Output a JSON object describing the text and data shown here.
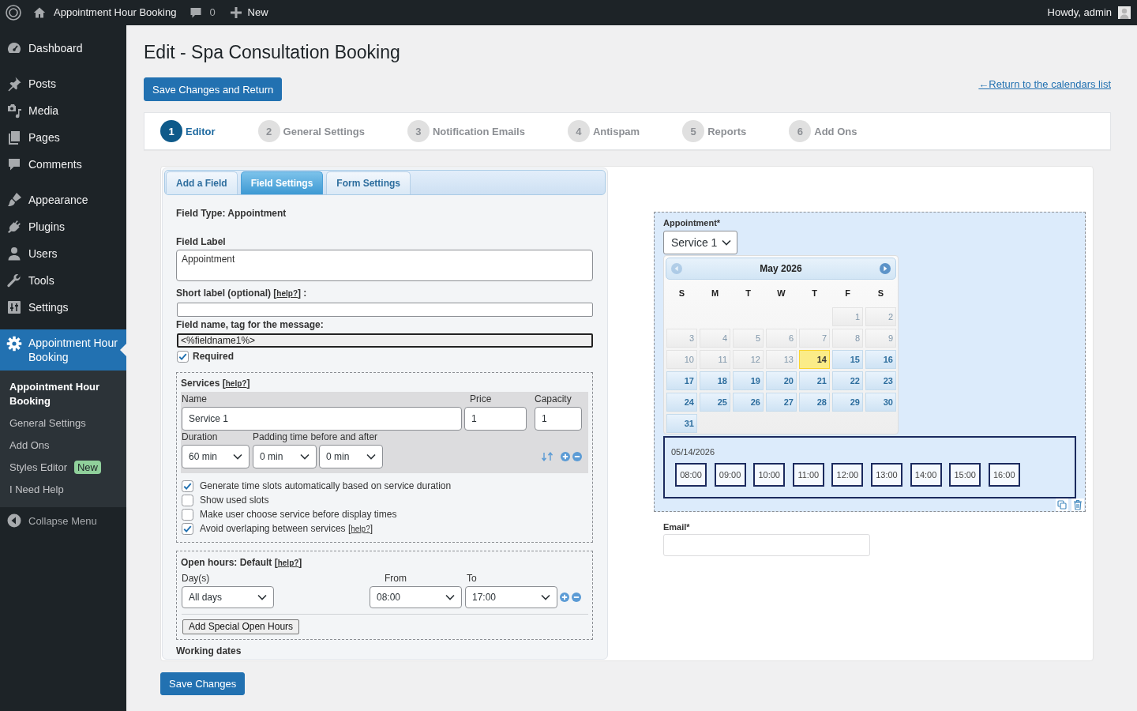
{
  "admin_bar": {
    "site_name": "Appointment Hour Booking",
    "comments_count": "0",
    "new_label": "New",
    "greeting": "Howdy, admin"
  },
  "sidebar": {
    "groups": [
      {
        "items": [
          {
            "label": "Dashboard",
            "selected": false
          }
        ]
      },
      {
        "items": [
          {
            "label": "Posts",
            "selected": false
          },
          {
            "label": "Media",
            "selected": false
          },
          {
            "label": "Pages",
            "selected": false
          },
          {
            "label": "Comments",
            "selected": false
          }
        ]
      },
      {
        "items": [
          {
            "label": "Appearance",
            "selected": false
          },
          {
            "label": "Plugins",
            "selected": false
          },
          {
            "label": "Users",
            "selected": false
          },
          {
            "label": "Tools",
            "selected": false
          },
          {
            "label": "Settings",
            "selected": false
          }
        ]
      },
      {
        "items": [
          {
            "label": "Appointment Hour Booking",
            "selected": true,
            "submenu": [
              {
                "label": "Appointment Hour Booking",
                "selected": true
              },
              {
                "label": "General Settings",
                "selected": false
              },
              {
                "label": "Add Ons",
                "selected": false
              },
              {
                "label": "Styles Editor",
                "selected": false,
                "badge": "New"
              },
              {
                "label": "I Need Help",
                "selected": false
              }
            ]
          }
        ]
      }
    ],
    "collapse_label": "Collapse Menu"
  },
  "page": {
    "title": "Edit - Spa Consultation Booking",
    "save_return_button": "Save Changes and Return",
    "return_link": "←Return to the calendars list"
  },
  "steps": [
    {
      "number": "1",
      "label": "Editor",
      "selected": true
    },
    {
      "number": "2",
      "label": "General Settings",
      "selected": false
    },
    {
      "number": "3",
      "label": "Notification Emails",
      "selected": false
    },
    {
      "number": "4",
      "label": "Antispam",
      "selected": false
    },
    {
      "number": "5",
      "label": "Reports",
      "selected": false
    },
    {
      "number": "6",
      "label": "Add Ons",
      "selected": false
    }
  ],
  "editor_tabs": [
    {
      "label": "Add a Field",
      "selected": false
    },
    {
      "label": "Field Settings",
      "selected": true
    },
    {
      "label": "Form Settings",
      "selected": false
    }
  ],
  "field_settings": {
    "field_type": "Field Type: Appointment",
    "field_label": {
      "label": "Field Label",
      "value": "Appointment"
    },
    "short_label": {
      "label": "Short label (optional)",
      "help": {
        "before": "[",
        "link": "help?",
        "after": "] :"
      }
    },
    "field_name": {
      "label": "Field name, tag for the message:",
      "value": "<%fieldname1%>"
    },
    "required": {
      "label": "Required",
      "checked": true
    },
    "services": {
      "title": "Services",
      "help": {
        "before": "[",
        "link": "help?",
        "after": "]"
      },
      "items": [
        {
          "name_label": "Name",
          "name": "Service 1",
          "price_label": "Price",
          "price": "1",
          "capacity_label": "Capacity",
          "capacity": "1",
          "duration_label": "Duration",
          "duration": "60 min",
          "padding_label": "Padding time before and after",
          "padding_before": "0 min",
          "padding_after": "0 min"
        }
      ],
      "options": [
        {
          "label": "Generate time slots automatically based on service duration",
          "checked": true
        },
        {
          "label": "Show used slots",
          "checked": false
        },
        {
          "label": "Make user choose service before display times",
          "checked": false
        },
        {
          "label": "Avoid overlaping between services",
          "checked": true,
          "help": {
            "before": "[",
            "link": "help?",
            "after": "]"
          }
        }
      ]
    },
    "open_hours": {
      "title": "Open hours: Default",
      "help": {
        "before": "[",
        "link": "help?",
        "after": "]"
      },
      "days_label": "Day(s)",
      "days": "All days",
      "from_label": "From",
      "from": "08:00",
      "to_label": "To",
      "to": "17:00",
      "special_button": "Add Special Open Hours"
    },
    "next_section": "Working dates"
  },
  "preview": {
    "appointment": {
      "label": "Appointment*",
      "service": "Service 1",
      "calendar": {
        "month": "May 2026",
        "prev_enabled": false,
        "next_enabled": true,
        "weekdays": [
          "S",
          "M",
          "T",
          "W",
          "T",
          "F",
          "S"
        ],
        "weeks": [
          [
            {
              "kind": "blank"
            },
            {
              "kind": "blank"
            },
            {
              "kind": "blank"
            },
            {
              "kind": "blank"
            },
            {
              "kind": "blank"
            },
            {
              "kind": "day",
              "label": "1",
              "available": false,
              "selected": false
            },
            {
              "kind": "day",
              "label": "2",
              "available": false,
              "selected": false
            }
          ],
          [
            {
              "kind": "day",
              "label": "3",
              "available": false,
              "selected": false
            },
            {
              "kind": "day",
              "label": "4",
              "available": false,
              "selected": false
            },
            {
              "kind": "day",
              "label": "5",
              "available": false,
              "selected": false
            },
            {
              "kind": "day",
              "label": "6",
              "available": false,
              "selected": false
            },
            {
              "kind": "day",
              "label": "7",
              "available": false,
              "selected": false
            },
            {
              "kind": "day",
              "label": "8",
              "available": false,
              "selected": false
            },
            {
              "kind": "day",
              "label": "9",
              "available": false,
              "selected": false
            }
          ],
          [
            {
              "kind": "day",
              "label": "10",
              "available": false,
              "selected": false
            },
            {
              "kind": "day",
              "label": "11",
              "available": false,
              "selected": false
            },
            {
              "kind": "day",
              "label": "12",
              "available": false,
              "selected": false
            },
            {
              "kind": "day",
              "label": "13",
              "available": false,
              "selected": false
            },
            {
              "kind": "day",
              "label": "14",
              "available": true,
              "selected": true
            },
            {
              "kind": "day",
              "label": "15",
              "available": true,
              "selected": false
            },
            {
              "kind": "day",
              "label": "16",
              "available": true,
              "selected": false
            }
          ],
          [
            {
              "kind": "day",
              "label": "17",
              "available": true,
              "selected": false
            },
            {
              "kind": "day",
              "label": "18",
              "available": true,
              "selected": false
            },
            {
              "kind": "day",
              "label": "19",
              "available": true,
              "selected": false
            },
            {
              "kind": "day",
              "label": "20",
              "available": true,
              "selected": false
            },
            {
              "kind": "day",
              "label": "21",
              "available": true,
              "selected": false
            },
            {
              "kind": "day",
              "label": "22",
              "available": true,
              "selected": false
            },
            {
              "kind": "day",
              "label": "23",
              "available": true,
              "selected": false
            }
          ],
          [
            {
              "kind": "day",
              "label": "24",
              "available": true,
              "selected": false
            },
            {
              "kind": "day",
              "label": "25",
              "available": true,
              "selected": false
            },
            {
              "kind": "day",
              "label": "26",
              "available": true,
              "selected": false
            },
            {
              "kind": "day",
              "label": "27",
              "available": true,
              "selected": false
            },
            {
              "kind": "day",
              "label": "28",
              "available": true,
              "selected": false
            },
            {
              "kind": "day",
              "label": "29",
              "available": true,
              "selected": false
            },
            {
              "kind": "day",
              "label": "30",
              "available": true,
              "selected": false
            }
          ],
          [
            {
              "kind": "day",
              "label": "31",
              "available": true,
              "selected": false
            }
          ]
        ]
      },
      "slots": {
        "date": "05/14/2026",
        "times": [
          {
            "label": "08:00",
            "selected": false
          },
          {
            "label": "09:00",
            "selected": false
          },
          {
            "label": "10:00",
            "selected": false
          },
          {
            "label": "11:00",
            "selected": false
          },
          {
            "label": "12:00",
            "selected": false
          },
          {
            "label": "13:00",
            "selected": false
          },
          {
            "label": "14:00",
            "selected": false
          },
          {
            "label": "15:00",
            "selected": false
          },
          {
            "label": "16:00",
            "selected": false
          }
        ]
      }
    },
    "email": {
      "label": "Email*"
    }
  },
  "save_button": "Save Changes"
}
